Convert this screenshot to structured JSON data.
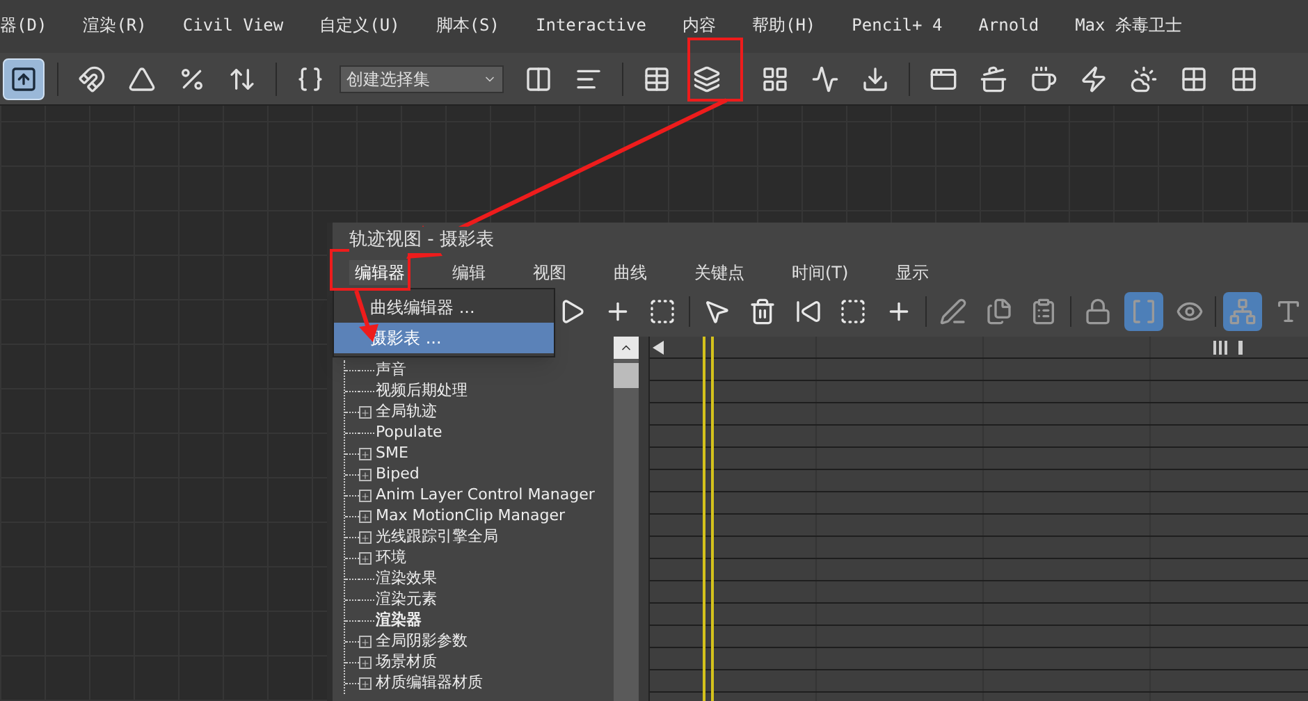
{
  "menu_bar": [
    "器(D)",
    "渲染(R)",
    "Civil View",
    "自定义(U)",
    "脚本(S)",
    "Interactive",
    "内容",
    "帮助(H)",
    "Pencil+ 4",
    "Arnold",
    "Max 杀毒卫士"
  ],
  "toolbar": {
    "selection_set": "创建选择集",
    "buttons": [
      {
        "selected": true
      },
      {
        "selected": false
      },
      {
        "selected": false
      },
      {
        "selected": false
      },
      {
        "selected": false
      },
      {
        "selected": false
      },
      {
        "selected": false
      },
      {
        "selected": false
      },
      {
        "selected": false
      },
      {
        "selected": false
      },
      {
        "selected": false
      },
      {
        "selected": false
      },
      {
        "selected": false
      },
      {
        "selected": false
      },
      {
        "selected": false
      },
      {
        "selected": false
      },
      {
        "selected": false
      },
      {
        "selected": false
      },
      {
        "selected": false
      },
      {
        "selected": false
      }
    ]
  },
  "track_view": {
    "title": "轨迹视图 - 摄影表",
    "menu": [
      {
        "label": "编辑器",
        "selected": true
      },
      {
        "label": "编辑",
        "selected": false
      },
      {
        "label": "视图",
        "selected": false
      },
      {
        "label": "曲线",
        "selected": false
      },
      {
        "label": "关键点",
        "selected": false
      },
      {
        "label": "时间(T)",
        "selected": false
      },
      {
        "label": "显示",
        "selected": false
      }
    ],
    "editor_menu": [
      {
        "label": "曲线编辑器 ...",
        "selected": false
      },
      {
        "label": "摄影表 ...",
        "selected": true
      }
    ],
    "toolbar": [
      {
        "selected": false
      },
      {
        "selected": false
      },
      {
        "selected": false
      },
      {
        "selected": false
      },
      {
        "selected": false
      },
      {
        "selected": false
      },
      {
        "selected": false
      },
      {
        "selected": false
      },
      {
        "selected": false
      },
      {
        "selected": false
      },
      {
        "selected": false
      },
      {
        "selected": false
      },
      {
        "selected": true
      },
      {
        "selected": false
      },
      {
        "selected": true
      },
      {
        "selected": false
      }
    ],
    "tree": [
      {
        "label": "声音",
        "kind": "leaf",
        "bold": false
      },
      {
        "label": "视频后期处理",
        "kind": "leaf",
        "bold": false
      },
      {
        "label": "全局轨迹",
        "kind": "group",
        "bold": false
      },
      {
        "label": "Populate",
        "kind": "leaf",
        "bold": false
      },
      {
        "label": "SME",
        "kind": "group",
        "bold": false
      },
      {
        "label": "Biped",
        "kind": "group",
        "bold": false
      },
      {
        "label": "Anim Layer Control Manager",
        "kind": "group",
        "bold": false
      },
      {
        "label": "Max MotionClip Manager",
        "kind": "group",
        "bold": false
      },
      {
        "label": "光线跟踪引擎全局",
        "kind": "group",
        "bold": false
      },
      {
        "label": "环境",
        "kind": "group",
        "bold": false
      },
      {
        "label": "渲染效果",
        "kind": "leaf",
        "bold": false
      },
      {
        "label": "渲染元素",
        "kind": "leaf",
        "bold": false
      },
      {
        "label": "渲染器",
        "kind": "leaf",
        "bold": true
      },
      {
        "label": "全局阴影参数",
        "kind": "group",
        "bold": false
      },
      {
        "label": "场景材质",
        "kind": "group",
        "bold": false
      },
      {
        "label": "材质编辑器材质",
        "kind": "group",
        "bold": false
      }
    ]
  }
}
